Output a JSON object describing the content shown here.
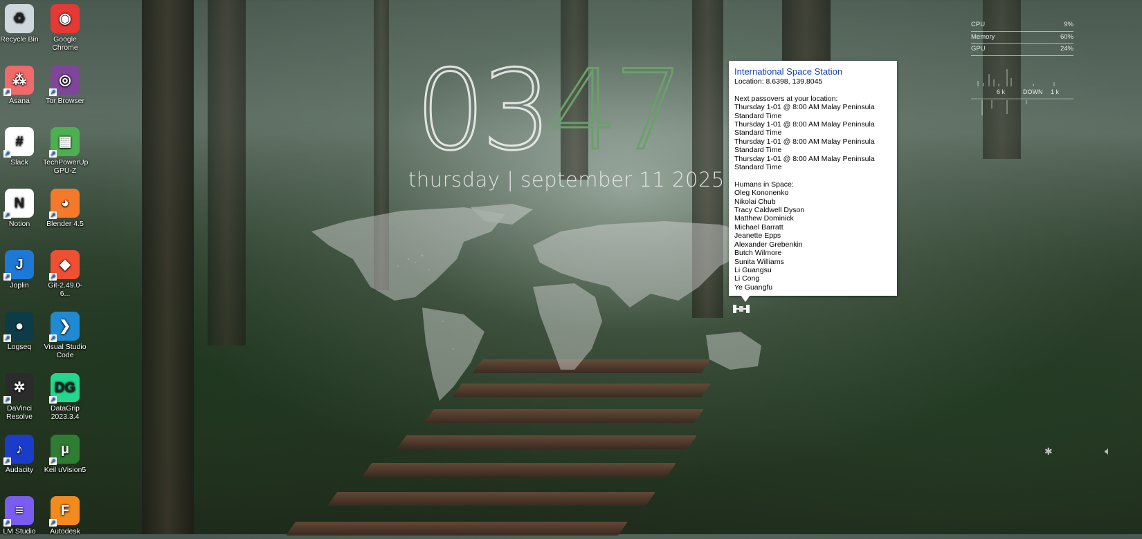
{
  "desktop_icons": [
    {
      "label": "Recycle Bin",
      "icon": "recycle-bin-icon",
      "color": "#cfd8dc",
      "glyph": "♻"
    },
    {
      "label": "Google Chrome",
      "icon": "chrome-icon",
      "color": "#e53935",
      "glyph": "◉"
    },
    {
      "label": "Asana",
      "icon": "asana-icon",
      "color": "#f06a6a",
      "glyph": "⁂"
    },
    {
      "label": "Tor Browser",
      "icon": "tor-browser-icon",
      "color": "#7d4698",
      "glyph": "◎"
    },
    {
      "label": "Slack",
      "icon": "slack-icon",
      "color": "#ffffff",
      "glyph": "#"
    },
    {
      "label": "TechPowerUp GPU-Z",
      "icon": "gpu-z-icon",
      "color": "#4caf50",
      "glyph": "▦"
    },
    {
      "label": "Notion",
      "icon": "notion-icon",
      "color": "#ffffff",
      "glyph": "N"
    },
    {
      "label": "Blender 4.5",
      "icon": "blender-icon",
      "color": "#f5792a",
      "glyph": "◕"
    },
    {
      "label": "Joplin",
      "icon": "joplin-icon",
      "color": "#1e78d6",
      "glyph": "J"
    },
    {
      "label": "Git-2.49.0-6...",
      "icon": "git-icon",
      "color": "#f05032",
      "glyph": "◆"
    },
    {
      "label": "Logseq",
      "icon": "logseq-icon",
      "color": "#0b3c48",
      "glyph": "●"
    },
    {
      "label": "Visual Studio Code",
      "icon": "vscode-icon",
      "color": "#1f8ad2",
      "glyph": "❯"
    },
    {
      "label": "DaVinci Resolve",
      "icon": "davinci-resolve-icon",
      "color": "#2b2b2b",
      "glyph": "✲"
    },
    {
      "label": "DataGrip 2023.3.4",
      "icon": "datagrip-icon",
      "color": "#22d88f",
      "glyph": "DG"
    },
    {
      "label": "Audacity",
      "icon": "audacity-icon",
      "color": "#1a3cc8",
      "glyph": "♪"
    },
    {
      "label": "Keil uVision5",
      "icon": "keil-icon",
      "color": "#2e7d32",
      "glyph": "μ"
    },
    {
      "label": "LM Studio",
      "icon": "lm-studio-icon",
      "color": "#7b5cf0",
      "glyph": "≡"
    },
    {
      "label": "Autodesk",
      "icon": "autodesk-fusion-icon",
      "color": "#f28a1e",
      "glyph": "F"
    }
  ],
  "clock": {
    "hours": "03",
    "minutes": "47",
    "date": "thursday | september 11 2025"
  },
  "iss": {
    "title": "International Space Station",
    "location": "Location: 8.6398, 139.8045",
    "passovers_heading": "Next passovers at your location:",
    "passovers": [
      "Thursday 1-01 @ 8:00 AM Malay Peninsula Standard Time",
      "Thursday 1-01 @ 8:00 AM Malay Peninsula Standard Time",
      "Thursday 1-01 @ 8:00 AM Malay Peninsula Standard Time",
      "Thursday 1-01 @ 8:00 AM Malay Peninsula Standard Time"
    ],
    "humans_heading": "Humans in Space:",
    "humans": [
      "Oleg Kononenko",
      "Nikolai Chub",
      "Tracy Caldwell Dyson",
      "Matthew Dominick",
      "Michael Barratt",
      "Jeanette Epps",
      "Alexander Grebenkin",
      "Butch Wilmore",
      "Sunita Williams",
      "Li Guangsu",
      "Li Cong",
      "Ye Guangfu"
    ]
  },
  "system_monitor": {
    "rows": [
      {
        "label": "CPU",
        "value": "9%"
      },
      {
        "label": "Memory",
        "value": "60%"
      },
      {
        "label": "GPU",
        "value": "24%"
      }
    ],
    "net_left": "6 k",
    "net_down": "DOWN",
    "net_right": "1 k"
  },
  "tray": {
    "bluetooth_icon": "bluetooth-icon",
    "volume_icon": "volume-icon"
  }
}
